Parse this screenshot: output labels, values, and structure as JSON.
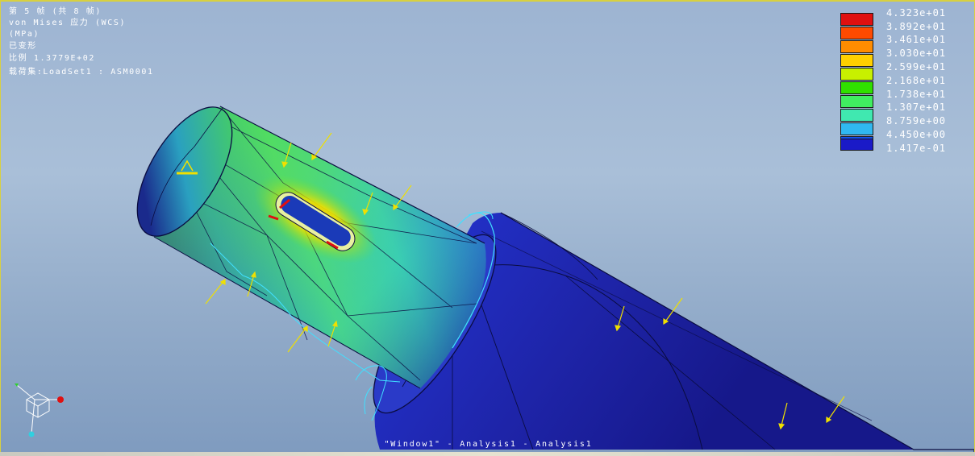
{
  "info": {
    "line1": "第 5 帧 (共 8 帧)",
    "line2": "von Mises 应力 (WCS)",
    "line3": "(MPa)",
    "line4": "已变形",
    "line5": "比例   1.3779E+02",
    "line6": "载荷集:LoadSet1 :  ASM0001"
  },
  "legend": {
    "values": [
      "4.323e+01",
      "3.892e+01",
      "3.461e+01",
      "3.030e+01",
      "2.599e+01",
      "2.168e+01",
      "1.738e+01",
      "1.307e+01",
      "8.759e+00",
      "4.450e+00",
      "1.417e-01"
    ],
    "colors": [
      "#e01010",
      "#ff4a00",
      "#ff8c00",
      "#ffd000",
      "#c8f000",
      "#30e000",
      "#40ee60",
      "#40e8b0",
      "#30b8f0",
      "#1050f0",
      "#1a1ac8"
    ]
  },
  "window_title": "\"Window1\" - Analysis1 - Analysis1"
}
